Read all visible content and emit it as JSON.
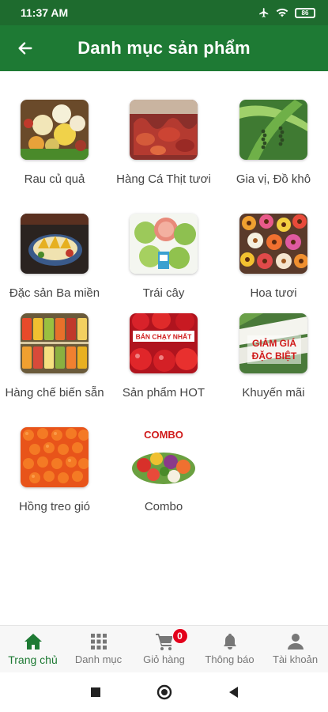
{
  "status": {
    "time": "11:37 AM",
    "battery": "86"
  },
  "header": {
    "title": "Danh mục sản phẩm"
  },
  "categories": [
    {
      "label": "Rau củ quả"
    },
    {
      "label": "Hàng Cá Thịt tươi"
    },
    {
      "label": "Gia vị, Đồ khô"
    },
    {
      "label": "Đặc sản Ba miền"
    },
    {
      "label": "Trái cây"
    },
    {
      "label": "Hoa tươi"
    },
    {
      "label": "Hàng chế biến sẵn"
    },
    {
      "label": "Sản phẩm HOT"
    },
    {
      "label": "Khuyến mãi"
    },
    {
      "label": "Hồng treo gió"
    },
    {
      "label": "Combo"
    }
  ],
  "image_text": {
    "best_seller": "BÁN CHẠY NHẤT",
    "discount_line1": "GIẢM GIÁ",
    "discount_line2": "ĐẶC BIỆT",
    "combo": "COMBO"
  },
  "nav": [
    {
      "label": "Trang chủ",
      "icon": "home-icon",
      "active": true
    },
    {
      "label": "Danh mục",
      "icon": "grid-icon"
    },
    {
      "label": "Giỏ hàng",
      "icon": "cart-icon",
      "badge": "0"
    },
    {
      "label": "Thông báo",
      "icon": "bell-icon"
    },
    {
      "label": "Tài khoản",
      "icon": "person-icon"
    }
  ],
  "colors": {
    "primary": "#1e7a34",
    "status_bar": "#1e6b2e",
    "badge": "#e3001b"
  }
}
